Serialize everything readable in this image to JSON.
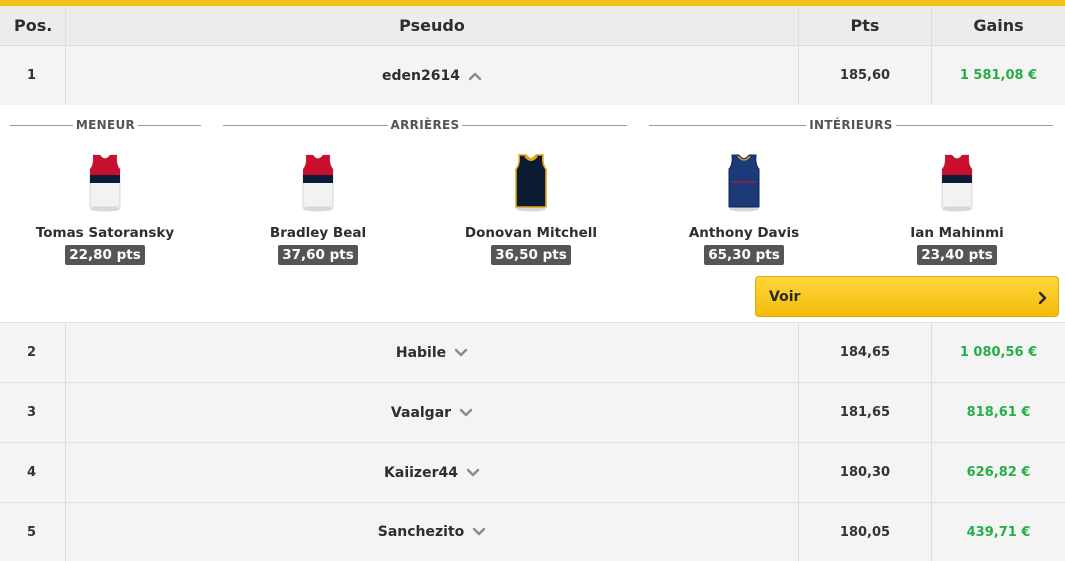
{
  "colors": {
    "accent": "#f2c21b",
    "gains": "#27ae48",
    "button": "#f8c822",
    "score_badge": "#555555"
  },
  "header": {
    "pos": "Pos.",
    "pseudo": "Pseudo",
    "pts": "Pts",
    "gains": "Gains"
  },
  "rows": [
    {
      "pos": "1",
      "pseudo": "eden2614",
      "pts": "185,60",
      "gains": "1 581,08 €",
      "expanded": true,
      "chevron": "chevron-up-icon"
    },
    {
      "pos": "2",
      "pseudo": "Habile",
      "pts": "184,65",
      "gains": "1 080,56 €",
      "expanded": false,
      "chevron": "chevron-down-icon"
    },
    {
      "pos": "3",
      "pseudo": "Vaalgar",
      "pts": "181,65",
      "gains": "818,61 €",
      "expanded": false,
      "chevron": "chevron-down-icon"
    },
    {
      "pos": "4",
      "pseudo": "Kaiizer44",
      "pts": "180,30",
      "gains": "626,82 €",
      "expanded": false,
      "chevron": "chevron-down-icon"
    },
    {
      "pos": "5",
      "pseudo": "Sanchezito",
      "pts": "180,05",
      "gains": "439,71 €",
      "expanded": false,
      "chevron": "chevron-down-icon"
    }
  ],
  "detail": {
    "sections": {
      "meneur": "MENEUR",
      "arrieres": "ARRIÈRES",
      "interieurs": "INTÉRIEURS"
    },
    "players": [
      {
        "name": "Tomas Satoransky",
        "score": "22,80 pts",
        "jersey": "white-red-navy"
      },
      {
        "name": "Bradley Beal",
        "score": "37,60 pts",
        "jersey": "white-red-navy"
      },
      {
        "name": "Donovan Mitchell",
        "score": "36,50 pts",
        "jersey": "navy-gold"
      },
      {
        "name": "Anthony Davis",
        "score": "65,30 pts",
        "jersey": "navy-blue"
      },
      {
        "name": "Ian Mahinmi",
        "score": "23,40 pts",
        "jersey": "white-red-navy"
      }
    ],
    "voir_label": "Voir"
  }
}
